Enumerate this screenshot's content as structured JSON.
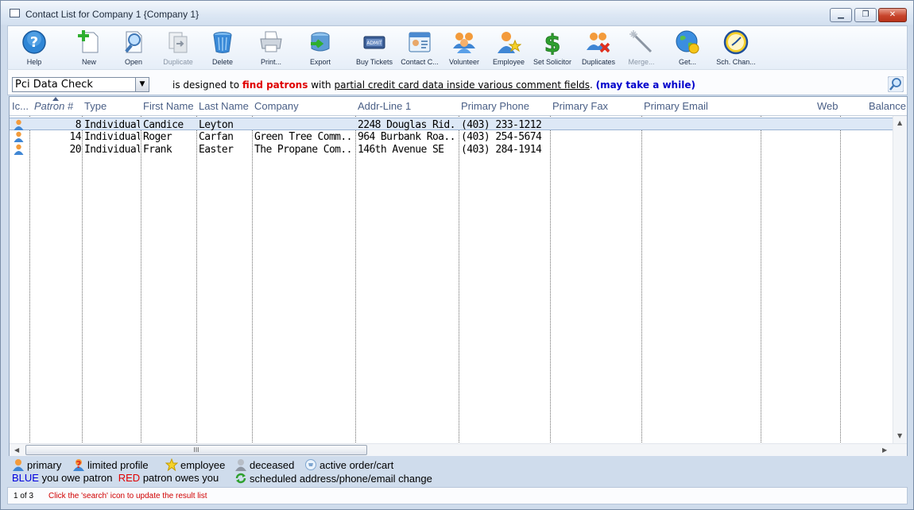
{
  "window": {
    "title": "Contact List for Company 1 {Company 1}",
    "minimize_label": "▁",
    "maximize_label": "❐",
    "close_label": "✕"
  },
  "toolbar": {
    "help": "Help",
    "new": "New",
    "open": "Open",
    "duplicate": "Duplicate",
    "delete": "Delete",
    "print": "Print...",
    "export": "Export",
    "buy_tickets": "Buy Tickets",
    "contact": "Contact C...",
    "volunteer": "Volunteer",
    "employee": "Employee",
    "set_solicitor": "Set Solicitor",
    "duplicates": "Duplicates",
    "merge": "Merge...",
    "get": "Get...",
    "sch_change": "Sch. Chan..."
  },
  "filter": {
    "selected": "Pci Data Check",
    "desc_1": "is designed to ",
    "desc_red": "find patrons",
    "desc_2": " with ",
    "desc_ul": "partial credit card data inside various comment fields",
    "desc_3": ". ",
    "desc_blue": "(may take a while)"
  },
  "grid": {
    "columns": {
      "icon": "Ic...",
      "patron": "Patron #",
      "type": "Type",
      "first": "First Name",
      "last": "Last Name",
      "company": "Company",
      "addr": "Addr-Line 1",
      "phone": "Primary Phone",
      "fax": "Primary Fax",
      "email": "Primary Email",
      "web": "Web",
      "balance": "Balance"
    },
    "rows": [
      {
        "patron": "8",
        "type": "Individual",
        "first": "Candice",
        "last": "Leyton",
        "company": "",
        "addr": "2248 Douglas Rid...",
        "phone": "(403) 233-1212",
        "fax": "",
        "email": "",
        "web": "",
        "balance": ""
      },
      {
        "patron": "14",
        "type": "Individual",
        "first": "Roger",
        "last": "Carfan",
        "company": "Green Tree Comm...",
        "addr": "964 Burbank Roa...",
        "phone": "(403) 254-5674",
        "fax": "",
        "email": "",
        "web": "",
        "balance": ""
      },
      {
        "patron": "20",
        "type": "Individual",
        "first": "Frank",
        "last": "Easter",
        "company": "The Propane Com...",
        "addr": "146th Avenue SE",
        "phone": "(403) 284-1914",
        "fax": "",
        "email": "",
        "web": "",
        "balance": ""
      }
    ],
    "hscroll_grip": "III"
  },
  "legend": {
    "primary": "primary",
    "limited": "limited profile",
    "employee": "employee",
    "deceased": "deceased",
    "active_order": "active order/cart",
    "blue": "BLUE",
    "blue_text": "you owe patron",
    "red": "RED",
    "red_text": "patron owes you",
    "scheduled": "scheduled address/phone/email change"
  },
  "status": {
    "count": "1 of 3",
    "message": "Click the 'search' icon to update the result list"
  },
  "icons": {
    "help": "help-icon",
    "new": "new-icon",
    "open": "open-icon",
    "duplicate": "duplicate-icon",
    "delete": "delete-icon",
    "print": "printer-icon",
    "export": "export-icon",
    "buy_tickets": "tickets-icon",
    "contact": "contact-card-icon",
    "volunteer": "volunteer-icon",
    "employee": "employee-icon",
    "set_solicitor": "dollar-icon",
    "duplicates": "duplicates-icon",
    "merge": "magic-wand-icon",
    "get": "globe-icon",
    "sch_change": "clock-icon",
    "search": "search-icon"
  },
  "colors": {
    "accent_red": "#e00000",
    "accent_blue": "#0000cc",
    "selection": "#dde8f6",
    "header_text": "#4a5f86"
  }
}
